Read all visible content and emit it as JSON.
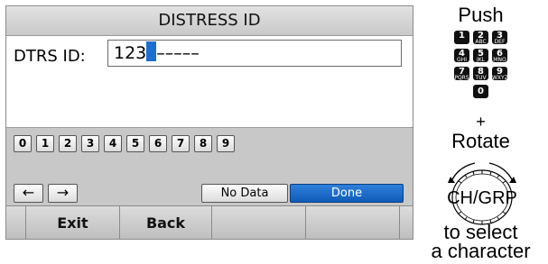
{
  "screen": {
    "title": "DISTRESS ID",
    "id_label": "DTRS ID:",
    "id_value": "123",
    "id_blanks": "–––––",
    "number_keys": [
      "0",
      "1",
      "2",
      "3",
      "4",
      "5",
      "6",
      "7",
      "8",
      "9"
    ],
    "left_arrow": "←",
    "right_arrow": "→",
    "no_data_label": "No Data",
    "done_label": "Done",
    "softkeys": [
      "Exit",
      "Back",
      "",
      ""
    ]
  },
  "instructions": {
    "push": "Push",
    "keypad": [
      {
        "digit": "1",
        "letters": ""
      },
      {
        "digit": "2",
        "letters": "ABC"
      },
      {
        "digit": "3",
        "letters": "DEF"
      },
      {
        "digit": "4",
        "letters": "GHI"
      },
      {
        "digit": "5",
        "letters": "JKL"
      },
      {
        "digit": "6",
        "letters": "MNO"
      },
      {
        "digit": "7",
        "letters": "PQRS"
      },
      {
        "digit": "8",
        "letters": "TUV"
      },
      {
        "digit": "9",
        "letters": "WXYZ"
      },
      {
        "digit": "0",
        "letters": ""
      }
    ],
    "plus": "+",
    "rotate": "Rotate",
    "dial_label": "CH/GRP",
    "to_select": "to select",
    "a_character": "a character"
  },
  "colors": {
    "done_button": "#1565c0",
    "cursor": "#1a6fd0",
    "title_bar": "#d0d0d0",
    "keypad_background": "#c8c8c8"
  }
}
